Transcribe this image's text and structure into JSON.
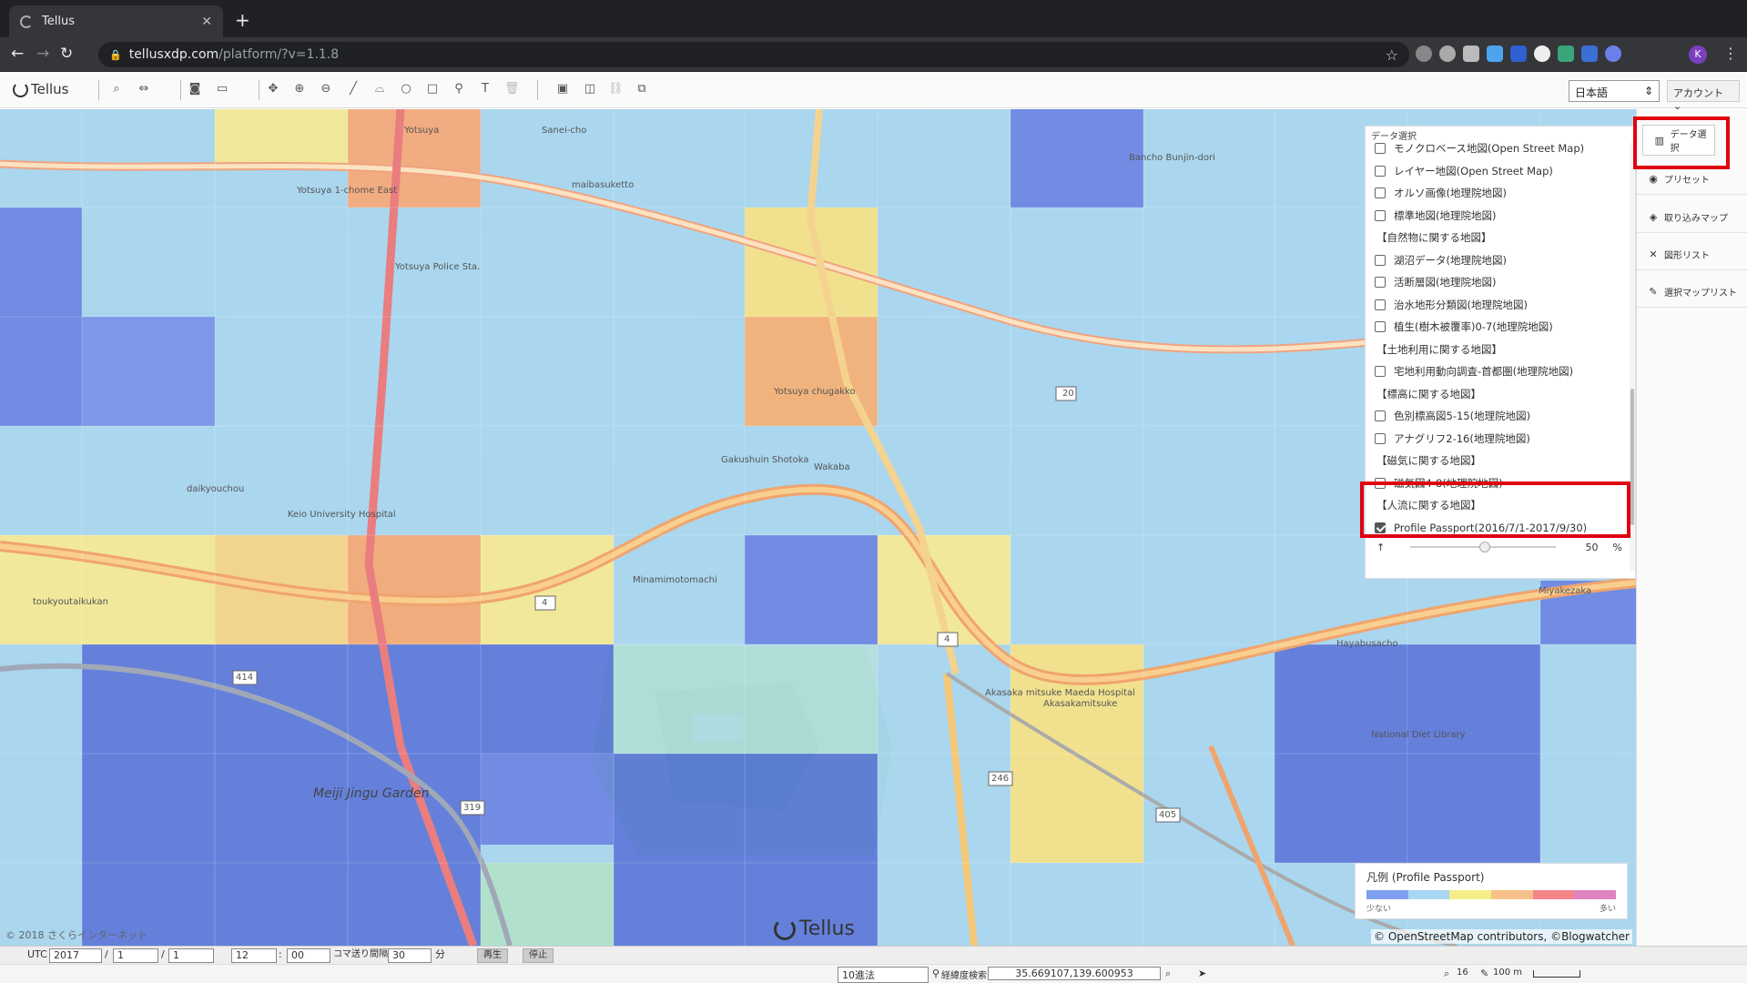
{
  "browser": {
    "tab_title": "Tellus",
    "url_host": "tellusxdp.com",
    "url_path": "/platform/?v=1.1.8",
    "avatar_letter": "K"
  },
  "toolbar": {
    "logo": "Tellus",
    "language": "日本語",
    "account": "アカウント"
  },
  "map": {
    "labels": [
      {
        "text": "Yotsuya"
      },
      {
        "text": "Yotsuya 1-chome East"
      },
      {
        "text": "Yotsuya Police Sta."
      },
      {
        "text": "Yotsuya chugakko"
      },
      {
        "text": "Gakushuin Shotoka"
      },
      {
        "text": "Wakaba"
      },
      {
        "text": "Minamimotomachi"
      },
      {
        "text": "Akasakamitsuke"
      },
      {
        "text": "Hayabusacho"
      },
      {
        "text": "National Diet Library"
      },
      {
        "text": "Meiji Jingu Garden"
      },
      {
        "text": "Keio University Hospital"
      },
      {
        "text": "daikyouchou"
      },
      {
        "text": "toukyoutaikukan"
      },
      {
        "text": "Miyakezaka"
      },
      {
        "text": "Akasaka mitsuke Maeda Hospital"
      },
      {
        "text": "Sanei-cho"
      },
      {
        "text": "Bancho Bunjin-dori"
      },
      {
        "text": "maibasuketto"
      }
    ],
    "route_numbers": [
      "20",
      "4",
      "414",
      "319",
      "246",
      "405",
      "4"
    ],
    "copyright_left": "© 2018 さくらインターネット",
    "watermark": "Tellus",
    "attribution": "© OpenStreetMap contributors, ©Blogwatcher"
  },
  "data_panel": {
    "title": "データ選択",
    "items": [
      {
        "label": "モノクロベース地図(Open Street Map)",
        "type": "check",
        "checked": false
      },
      {
        "label": "レイヤー地図(Open Street Map)",
        "type": "check",
        "checked": false
      },
      {
        "label": "オルソ画像(地理院地図)",
        "type": "check",
        "checked": false
      },
      {
        "label": "標準地図(地理院地図)",
        "type": "check",
        "checked": false
      },
      {
        "label": "【自然物に関する地図】",
        "type": "header"
      },
      {
        "label": "湖沼データ(地理院地図)",
        "type": "check",
        "checked": false
      },
      {
        "label": "活断層図(地理院地図)",
        "type": "check",
        "checked": false
      },
      {
        "label": "治水地形分類図(地理院地図)",
        "type": "check",
        "checked": false
      },
      {
        "label": "植生(樹木被覆率)0-7(地理院地図)",
        "type": "check",
        "checked": false
      },
      {
        "label": "【土地利用に関する地図】",
        "type": "header"
      },
      {
        "label": "宅地利用動向調査-首都圏(地理院地図)",
        "type": "check",
        "checked": false
      },
      {
        "label": "【標高に関する地図】",
        "type": "header"
      },
      {
        "label": "色別標高図5-15(地理院地図)",
        "type": "check",
        "checked": false
      },
      {
        "label": "アナグリフ2-16(地理院地図)",
        "type": "check",
        "checked": false
      },
      {
        "label": "【磁気に関する地図】",
        "type": "header"
      },
      {
        "label": "磁気図4-8(地理院地図)",
        "type": "check",
        "checked": false
      },
      {
        "label": "【人流に関する地図】",
        "type": "header"
      },
      {
        "label": "Profile Passport(2016/7/1-2017/9/30)",
        "type": "check",
        "checked": true
      }
    ],
    "opacity_value": "50",
    "opacity_unit": "%"
  },
  "sidebar": {
    "items": [
      {
        "label": "データ選択",
        "icon": "book-icon"
      },
      {
        "label": "プリセット",
        "icon": "palette-icon"
      },
      {
        "label": "取り込みマップ",
        "icon": "layers-icon"
      },
      {
        "label": "図形リスト",
        "icon": "shapes-icon"
      },
      {
        "label": "選択マップリスト",
        "icon": "pin-icon"
      }
    ]
  },
  "legend": {
    "title": "凡例 (Profile Passport)",
    "low": "少ない",
    "high": "多い",
    "colors": [
      "#7f9ff0",
      "#a9d6f5",
      "#f6ec8a",
      "#f7c08a",
      "#f4868a",
      "#e083c0"
    ]
  },
  "time_controls": {
    "utc_label": "UTC",
    "year": "2017",
    "month": "1",
    "day": "1",
    "hour": "12",
    "minute": "00",
    "sep1": "/",
    "sep2": "/",
    "sep3": ":",
    "interval_label": "コマ送り間隔",
    "interval": "30",
    "interval_unit": "分",
    "play": "再生",
    "stop": "停止"
  },
  "status": {
    "coord_format": "10進法",
    "coord_search_label": "経緯度検索",
    "coords": "35.669107,139.600953",
    "zoom": "16",
    "scale": "100 m"
  }
}
